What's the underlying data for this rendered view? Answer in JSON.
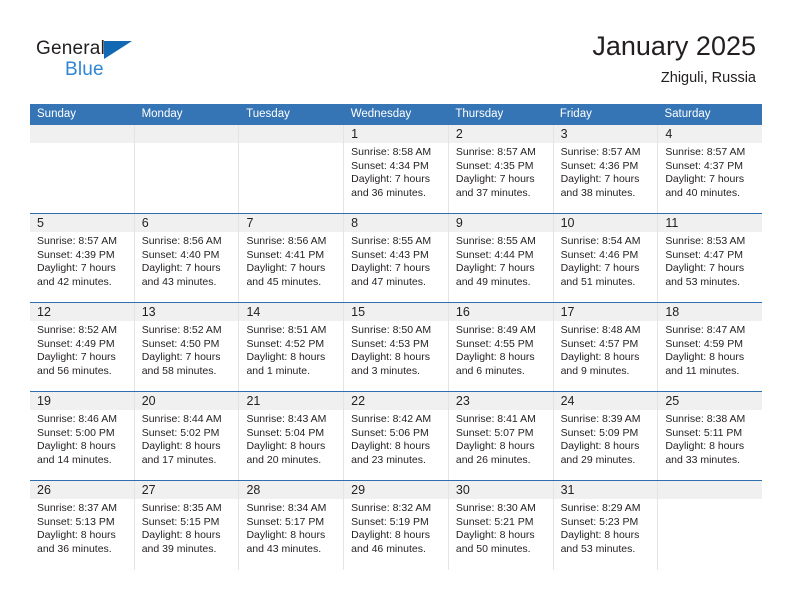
{
  "brand": {
    "name_top": "General",
    "name_bottom": "Blue",
    "triangle_color": "#1268b3",
    "blue_text_color": "#2e86d4"
  },
  "header": {
    "title": "January 2025",
    "location": "Zhiguli, Russia"
  },
  "colors": {
    "header_row_bg": "#3575b5",
    "header_row_text": "#ffffff",
    "week_separator": "#2f6fb0",
    "daynum_band_bg": "#f0f0f0",
    "cell_divider": "#e4e4e4",
    "body_text": "#231f20"
  },
  "weekdays": [
    "Sunday",
    "Monday",
    "Tuesday",
    "Wednesday",
    "Thursday",
    "Friday",
    "Saturday"
  ],
  "weeks": [
    [
      {
        "day": "",
        "empty": true
      },
      {
        "day": "",
        "empty": true
      },
      {
        "day": "",
        "empty": true
      },
      {
        "day": "1",
        "sunrise": "Sunrise: 8:58 AM",
        "sunset": "Sunset: 4:34 PM",
        "daylight1": "Daylight: 7 hours",
        "daylight2": "and 36 minutes."
      },
      {
        "day": "2",
        "sunrise": "Sunrise: 8:57 AM",
        "sunset": "Sunset: 4:35 PM",
        "daylight1": "Daylight: 7 hours",
        "daylight2": "and 37 minutes."
      },
      {
        "day": "3",
        "sunrise": "Sunrise: 8:57 AM",
        "sunset": "Sunset: 4:36 PM",
        "daylight1": "Daylight: 7 hours",
        "daylight2": "and 38 minutes."
      },
      {
        "day": "4",
        "sunrise": "Sunrise: 8:57 AM",
        "sunset": "Sunset: 4:37 PM",
        "daylight1": "Daylight: 7 hours",
        "daylight2": "and 40 minutes."
      }
    ],
    [
      {
        "day": "5",
        "sunrise": "Sunrise: 8:57 AM",
        "sunset": "Sunset: 4:39 PM",
        "daylight1": "Daylight: 7 hours",
        "daylight2": "and 42 minutes."
      },
      {
        "day": "6",
        "sunrise": "Sunrise: 8:56 AM",
        "sunset": "Sunset: 4:40 PM",
        "daylight1": "Daylight: 7 hours",
        "daylight2": "and 43 minutes."
      },
      {
        "day": "7",
        "sunrise": "Sunrise: 8:56 AM",
        "sunset": "Sunset: 4:41 PM",
        "daylight1": "Daylight: 7 hours",
        "daylight2": "and 45 minutes."
      },
      {
        "day": "8",
        "sunrise": "Sunrise: 8:55 AM",
        "sunset": "Sunset: 4:43 PM",
        "daylight1": "Daylight: 7 hours",
        "daylight2": "and 47 minutes."
      },
      {
        "day": "9",
        "sunrise": "Sunrise: 8:55 AM",
        "sunset": "Sunset: 4:44 PM",
        "daylight1": "Daylight: 7 hours",
        "daylight2": "and 49 minutes."
      },
      {
        "day": "10",
        "sunrise": "Sunrise: 8:54 AM",
        "sunset": "Sunset: 4:46 PM",
        "daylight1": "Daylight: 7 hours",
        "daylight2": "and 51 minutes."
      },
      {
        "day": "11",
        "sunrise": "Sunrise: 8:53 AM",
        "sunset": "Sunset: 4:47 PM",
        "daylight1": "Daylight: 7 hours",
        "daylight2": "and 53 minutes."
      }
    ],
    [
      {
        "day": "12",
        "sunrise": "Sunrise: 8:52 AM",
        "sunset": "Sunset: 4:49 PM",
        "daylight1": "Daylight: 7 hours",
        "daylight2": "and 56 minutes."
      },
      {
        "day": "13",
        "sunrise": "Sunrise: 8:52 AM",
        "sunset": "Sunset: 4:50 PM",
        "daylight1": "Daylight: 7 hours",
        "daylight2": "and 58 minutes."
      },
      {
        "day": "14",
        "sunrise": "Sunrise: 8:51 AM",
        "sunset": "Sunset: 4:52 PM",
        "daylight1": "Daylight: 8 hours",
        "daylight2": "and 1 minute."
      },
      {
        "day": "15",
        "sunrise": "Sunrise: 8:50 AM",
        "sunset": "Sunset: 4:53 PM",
        "daylight1": "Daylight: 8 hours",
        "daylight2": "and 3 minutes."
      },
      {
        "day": "16",
        "sunrise": "Sunrise: 8:49 AM",
        "sunset": "Sunset: 4:55 PM",
        "daylight1": "Daylight: 8 hours",
        "daylight2": "and 6 minutes."
      },
      {
        "day": "17",
        "sunrise": "Sunrise: 8:48 AM",
        "sunset": "Sunset: 4:57 PM",
        "daylight1": "Daylight: 8 hours",
        "daylight2": "and 9 minutes."
      },
      {
        "day": "18",
        "sunrise": "Sunrise: 8:47 AM",
        "sunset": "Sunset: 4:59 PM",
        "daylight1": "Daylight: 8 hours",
        "daylight2": "and 11 minutes."
      }
    ],
    [
      {
        "day": "19",
        "sunrise": "Sunrise: 8:46 AM",
        "sunset": "Sunset: 5:00 PM",
        "daylight1": "Daylight: 8 hours",
        "daylight2": "and 14 minutes."
      },
      {
        "day": "20",
        "sunrise": "Sunrise: 8:44 AM",
        "sunset": "Sunset: 5:02 PM",
        "daylight1": "Daylight: 8 hours",
        "daylight2": "and 17 minutes."
      },
      {
        "day": "21",
        "sunrise": "Sunrise: 8:43 AM",
        "sunset": "Sunset: 5:04 PM",
        "daylight1": "Daylight: 8 hours",
        "daylight2": "and 20 minutes."
      },
      {
        "day": "22",
        "sunrise": "Sunrise: 8:42 AM",
        "sunset": "Sunset: 5:06 PM",
        "daylight1": "Daylight: 8 hours",
        "daylight2": "and 23 minutes."
      },
      {
        "day": "23",
        "sunrise": "Sunrise: 8:41 AM",
        "sunset": "Sunset: 5:07 PM",
        "daylight1": "Daylight: 8 hours",
        "daylight2": "and 26 minutes."
      },
      {
        "day": "24",
        "sunrise": "Sunrise: 8:39 AM",
        "sunset": "Sunset: 5:09 PM",
        "daylight1": "Daylight: 8 hours",
        "daylight2": "and 29 minutes."
      },
      {
        "day": "25",
        "sunrise": "Sunrise: 8:38 AM",
        "sunset": "Sunset: 5:11 PM",
        "daylight1": "Daylight: 8 hours",
        "daylight2": "and 33 minutes."
      }
    ],
    [
      {
        "day": "26",
        "sunrise": "Sunrise: 8:37 AM",
        "sunset": "Sunset: 5:13 PM",
        "daylight1": "Daylight: 8 hours",
        "daylight2": "and 36 minutes."
      },
      {
        "day": "27",
        "sunrise": "Sunrise: 8:35 AM",
        "sunset": "Sunset: 5:15 PM",
        "daylight1": "Daylight: 8 hours",
        "daylight2": "and 39 minutes."
      },
      {
        "day": "28",
        "sunrise": "Sunrise: 8:34 AM",
        "sunset": "Sunset: 5:17 PM",
        "daylight1": "Daylight: 8 hours",
        "daylight2": "and 43 minutes."
      },
      {
        "day": "29",
        "sunrise": "Sunrise: 8:32 AM",
        "sunset": "Sunset: 5:19 PM",
        "daylight1": "Daylight: 8 hours",
        "daylight2": "and 46 minutes."
      },
      {
        "day": "30",
        "sunrise": "Sunrise: 8:30 AM",
        "sunset": "Sunset: 5:21 PM",
        "daylight1": "Daylight: 8 hours",
        "daylight2": "and 50 minutes."
      },
      {
        "day": "31",
        "sunrise": "Sunrise: 8:29 AM",
        "sunset": "Sunset: 5:23 PM",
        "daylight1": "Daylight: 8 hours",
        "daylight2": "and 53 minutes."
      },
      {
        "day": "",
        "empty": true
      }
    ]
  ]
}
